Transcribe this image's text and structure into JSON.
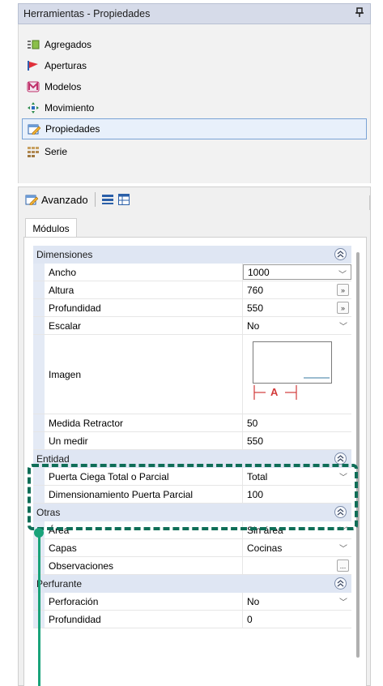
{
  "window": {
    "title": "Herramientas - Propiedades",
    "pin_glyph": "p"
  },
  "nav": {
    "items": [
      {
        "label": "Agregados",
        "icon": "aggregates-icon"
      },
      {
        "label": "Aperturas",
        "icon": "openings-icon"
      },
      {
        "label": "Modelos",
        "icon": "models-icon"
      },
      {
        "label": "Movimiento",
        "icon": "move-icon"
      },
      {
        "label": "Propiedades",
        "icon": "properties-icon",
        "active": true
      },
      {
        "label": "Serie",
        "icon": "series-icon"
      }
    ]
  },
  "toolbar": {
    "advanced_label": "Avanzado"
  },
  "tabs": [
    {
      "label": "Módulos"
    }
  ],
  "sections": {
    "dimensiones": {
      "title": "Dimensiones",
      "rows": [
        {
          "name": "Ancho",
          "value": "1000",
          "control": "dropdown"
        },
        {
          "name": "Altura",
          "value": "760",
          "control": "ellipsis"
        },
        {
          "name": "Profundidad",
          "value": "550",
          "control": "ellipsis"
        },
        {
          "name": "Escalar",
          "value": "No",
          "control": "dropdown"
        },
        {
          "name": "Imagen",
          "value": "",
          "control": "image"
        },
        {
          "name": "Medida Retractor",
          "value": "50"
        },
        {
          "name": "Un medir",
          "value": "550"
        }
      ]
    },
    "entidad": {
      "title": "Entidad",
      "rows": [
        {
          "name": "Puerta Ciega Total o Parcial",
          "value": "Total",
          "control": "dropdown"
        },
        {
          "name": "Dimensionamiento Puerta Parcial",
          "value": "100"
        }
      ]
    },
    "otras": {
      "title": "Otras",
      "rows": [
        {
          "name": "Área",
          "value": "Sin área",
          "control": "dropdown"
        },
        {
          "name": "Capas",
          "value": "Cocinas",
          "control": "dropdown"
        },
        {
          "name": "Observaciones",
          "value": "",
          "control": "ellipsis"
        }
      ]
    },
    "perfurante": {
      "title": "Perfurante",
      "rows": [
        {
          "name": "Perforación",
          "value": "No",
          "control": "dropdown"
        },
        {
          "name": "Profundidad",
          "value": "0"
        }
      ]
    }
  },
  "image_preview": {
    "label": "A"
  },
  "controls": {
    "dropdown_glyph": "﹀",
    "ellipsis_glyph": "»",
    "dots_glyph": "...",
    "collapse_glyph": "⌃"
  },
  "colors": {
    "section_header": "#dfe6f3",
    "highlight": "#0f6e57",
    "pointer": "#1aa37a",
    "active_border": "#7aa3d6"
  }
}
